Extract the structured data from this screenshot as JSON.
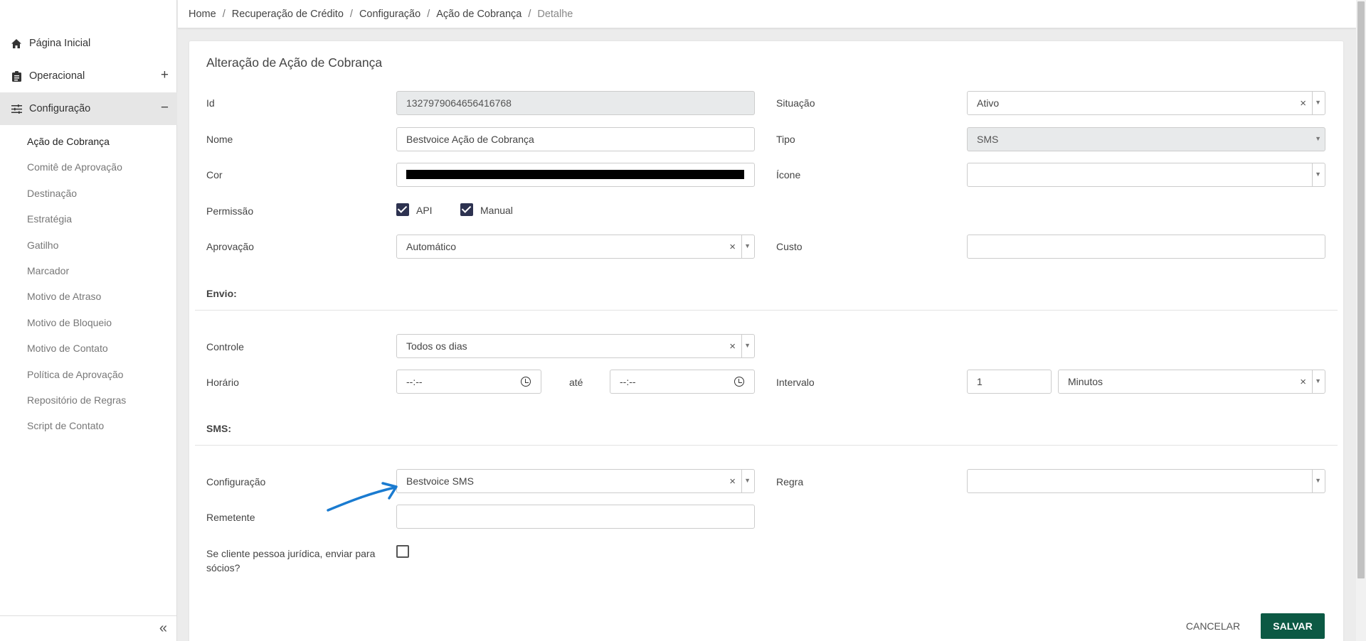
{
  "breadcrumb": {
    "items": [
      "Home",
      "Recuperação de Crédito",
      "Configuração",
      "Ação de Cobrança"
    ],
    "current": "Detalhe",
    "separator": "/"
  },
  "sidebar": {
    "home": {
      "label": "Página Inicial",
      "icon": "home-icon"
    },
    "operacional": {
      "label": "Operacional",
      "icon": "clipboard-icon",
      "toggle": "+"
    },
    "configuracao": {
      "label": "Configuração",
      "icon": "sliders-icon",
      "toggle": "−"
    },
    "subitems": [
      {
        "label": "Ação de Cobrança",
        "active": true
      },
      {
        "label": "Comitê de Aprovação",
        "active": false
      },
      {
        "label": "Destinação",
        "active": false
      },
      {
        "label": "Estratégia",
        "active": false
      },
      {
        "label": "Gatilho",
        "active": false
      },
      {
        "label": "Marcador",
        "active": false
      },
      {
        "label": "Motivo de Atraso",
        "active": false
      },
      {
        "label": "Motivo de Bloqueio",
        "active": false
      },
      {
        "label": "Motivo de Contato",
        "active": false
      },
      {
        "label": "Política de Aprovação",
        "active": false
      },
      {
        "label": "Repositório de Regras",
        "active": false
      },
      {
        "label": "Script de Contato",
        "active": false
      }
    ],
    "collapse_glyph": "«"
  },
  "form": {
    "title": "Alteração de Ação de Cobrança",
    "id": {
      "label": "Id",
      "value": "1327979064656416768"
    },
    "situacao": {
      "label": "Situação",
      "value": "Ativo"
    },
    "nome": {
      "label": "Nome",
      "value": "Bestvoice Ação de Cobrança"
    },
    "tipo": {
      "label": "Tipo",
      "value": "SMS"
    },
    "cor": {
      "label": "Cor",
      "value_color": "#000000"
    },
    "icone": {
      "label": "Ícone",
      "value": ""
    },
    "permissao": {
      "label": "Permissão",
      "api_label": "API",
      "api_checked": true,
      "manual_label": "Manual",
      "manual_checked": true
    },
    "aprovacao": {
      "label": "Aprovação",
      "value": "Automático"
    },
    "custo": {
      "label": "Custo",
      "value": ""
    },
    "envio": {
      "section_label": "Envio:",
      "controle": {
        "label": "Controle",
        "value": "Todos os dias"
      },
      "horario": {
        "label": "Horário",
        "from_value": "--:--",
        "to_label": "até",
        "to_value": "--:--"
      },
      "intervalo": {
        "label": "Intervalo",
        "value": "1",
        "unit": "Minutos"
      }
    },
    "sms": {
      "section_label": "SMS:",
      "configuracao": {
        "label": "Configuração",
        "value": "Bestvoice SMS"
      },
      "regra": {
        "label": "Regra",
        "value": ""
      },
      "remetente": {
        "label": "Remetente",
        "value": ""
      },
      "socios": {
        "label_line1": "Se cliente pessoa jurídica, enviar para",
        "label_line2": "sócios?",
        "checked": false
      }
    }
  },
  "actions": {
    "cancel": "CANCELAR",
    "save": "SALVAR"
  },
  "colors": {
    "primary": "#0c5944",
    "checkbox": "#2d3250",
    "annotation_arrow": "#1a7bd0"
  },
  "glyphs": {
    "clear": "×",
    "dropdown": "▼"
  }
}
